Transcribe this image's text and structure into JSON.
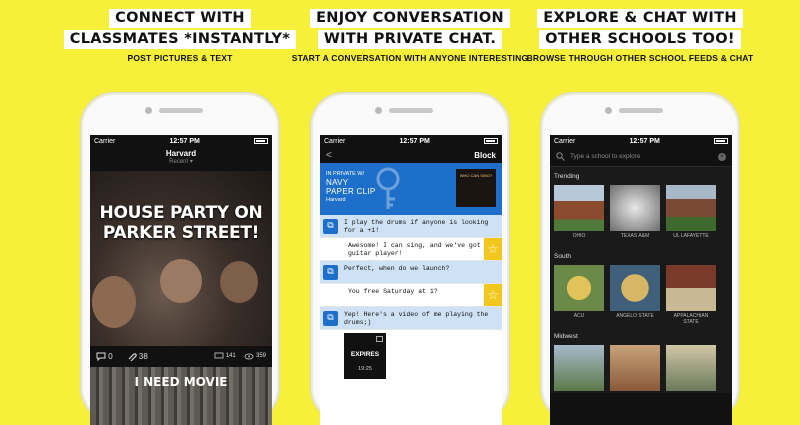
{
  "panels": [
    {
      "headline": [
        "CONNECT WITH",
        "CLASSMATES *INSTANTLY*"
      ],
      "subtitle": "POST PICTURES & TEXT",
      "phone": {
        "status": {
          "carrier": "Carrier",
          "time": "12:57 PM"
        },
        "nav_title": "Harvard",
        "nav_sub": "Recent ▾",
        "post_title": "HOUSE PARTY ON PARKER STREET!",
        "actions": {
          "comments": "0",
          "likes": "38",
          "messages": "141",
          "views": "359"
        },
        "next_post_title": "I NEED MOVIE"
      }
    },
    {
      "headline": [
        "ENJOY CONVERSATION",
        "WITH PRIVATE CHAT."
      ],
      "subtitle": "START A CONVERSATION WITH ANYONE INTERESTING",
      "phone": {
        "status": {
          "carrier": "Carrier",
          "time": "12:57 PM"
        },
        "back": "<",
        "block_label": "Block",
        "chat_header": {
          "line1": "IN PRIVATE W/",
          "name": "NAVY\nPAPER CLIP",
          "school": "Harvard",
          "thumb_text": "WHO CAN SING?"
        },
        "messages": [
          {
            "dir": "in",
            "text": "I play the drums if anyone is looking for a +1!"
          },
          {
            "dir": "out",
            "text": "Awesome! I can sing, and we've got a guitar player!",
            "starred": true
          },
          {
            "dir": "in",
            "text": "Perfect, when do we launch?"
          },
          {
            "dir": "out",
            "text": "You free Saturday at 1?",
            "starred": true
          },
          {
            "dir": "in",
            "text": "Yep! Here's a video of me playing the drums;)"
          }
        ],
        "expires": {
          "label": "EXPIRES",
          "time": "19:25"
        }
      }
    },
    {
      "headline": [
        "EXPLORE & CHAT WITH",
        "OTHER SCHOOLS TOO!"
      ],
      "subtitle": "BROWSE THROUGH OTHER SCHOOL FEEDS & CHAT",
      "phone": {
        "status": {
          "carrier": "Carrier",
          "time": "12:57 PM"
        },
        "search_placeholder": "Type a school to explore",
        "sections": [
          {
            "name": "Trending",
            "schools": [
              "OHIO",
              "TEXAS A&M",
              "UL LAFAYETTE"
            ]
          },
          {
            "name": "South",
            "schools": [
              "ACU",
              "ANGELO STATE",
              "APPALACHIAN STATE"
            ]
          },
          {
            "name": "Midwest",
            "schools": [
              "",
              "",
              ""
            ]
          }
        ]
      }
    }
  ],
  "colors": {
    "background": "#f7f03a",
    "chat_blue": "#1e6fc9",
    "star_yellow": "#f2c81e"
  }
}
